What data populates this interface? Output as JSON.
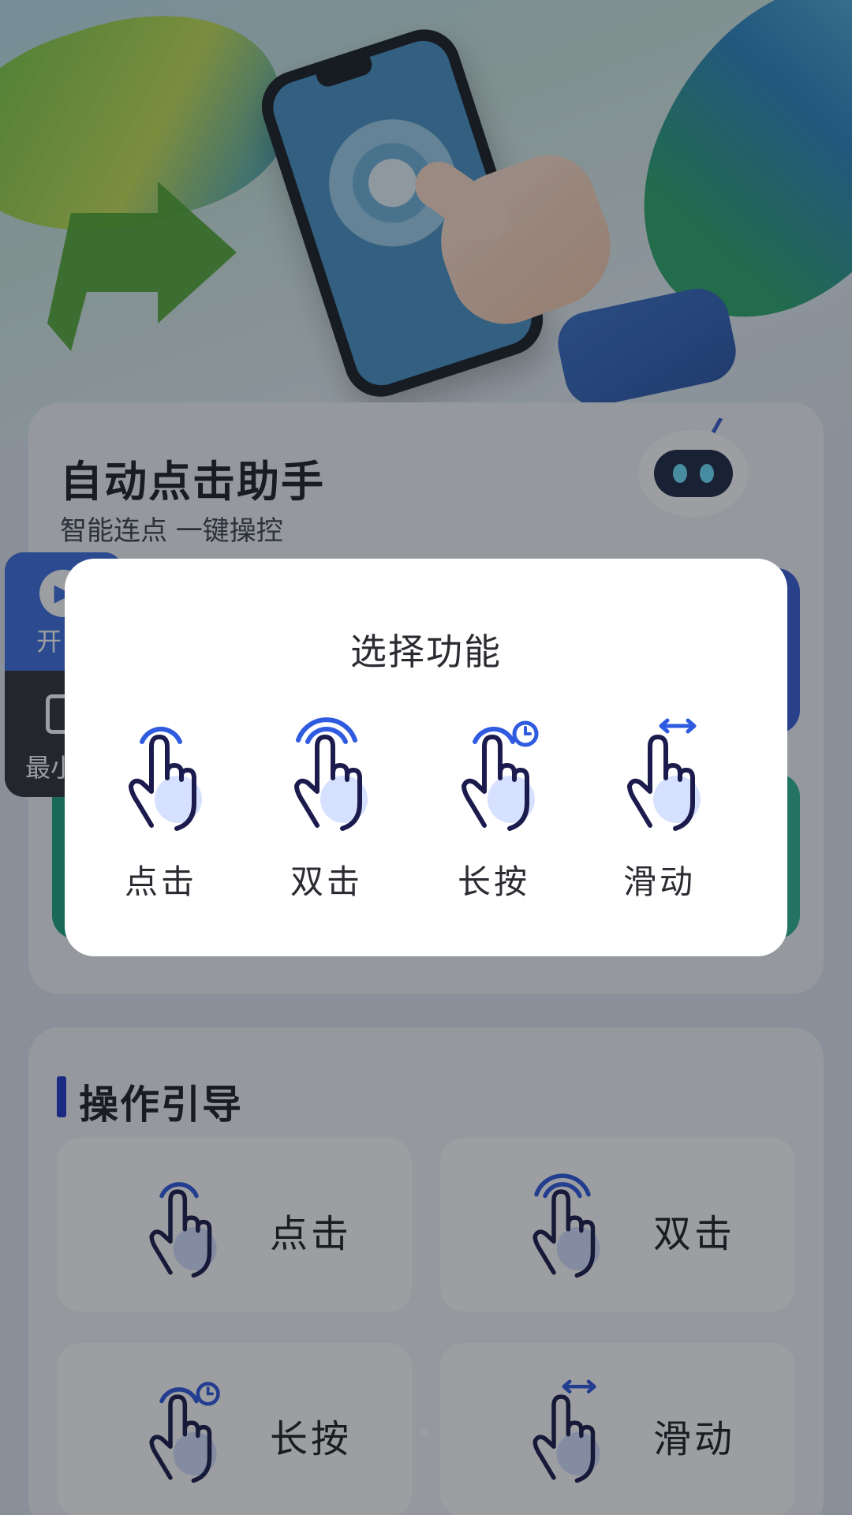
{
  "app": {
    "title": "自动点击助手",
    "subtitle": "智能连点 一键操控"
  },
  "floating_panel": {
    "start_label": "开",
    "minimize_label": "最小"
  },
  "guide": {
    "title": "操作引导",
    "items": [
      {
        "label": "点击",
        "icon": "tap-icon"
      },
      {
        "label": "双击",
        "icon": "double-tap-icon"
      },
      {
        "label": "长按",
        "icon": "long-press-icon"
      },
      {
        "label": "滑动",
        "icon": "swipe-icon"
      }
    ]
  },
  "pager": {
    "count": 5,
    "active_index": 3
  },
  "dialog": {
    "title": "选择功能",
    "options": [
      {
        "label": "点击",
        "icon": "tap-icon"
      },
      {
        "label": "双击",
        "icon": "double-tap-icon"
      },
      {
        "label": "长按",
        "icon": "long-press-icon"
      },
      {
        "label": "滑动",
        "icon": "swipe-icon"
      }
    ]
  },
  "colors": {
    "accent": "#2f5be0",
    "hand_outline": "#1b1b4d",
    "hand_fill": "#d6e0ff",
    "overlay": "#14181f"
  }
}
